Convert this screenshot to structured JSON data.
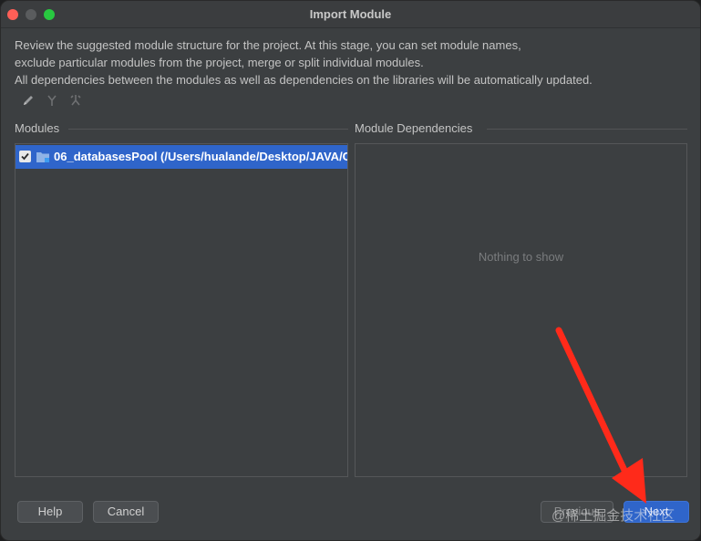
{
  "window": {
    "title": "Import Module"
  },
  "description": {
    "line1": "Review the suggested module structure for the project. At this stage, you can set module names,",
    "line2": "exclude particular modules from the project, merge or split individual modules.",
    "line3": "All dependencies between the modules as well as dependencies on the libraries will be automatically updated."
  },
  "toolbar": {
    "icons": [
      "pencil-icon",
      "merge-icon",
      "split-icon"
    ]
  },
  "modules": {
    "label": "Modules",
    "items": [
      {
        "checked": true,
        "text": "06_databasesPool (/Users/hualande/Desktop/JAVA/Co"
      }
    ]
  },
  "dependencies": {
    "label": "Module Dependencies",
    "empty_text": "Nothing to show"
  },
  "buttons": {
    "help": "Help",
    "cancel": "Cancel",
    "previous": "Previous",
    "next": "Next"
  },
  "watermark": "@稀土掘金技术社区",
  "colors": {
    "selection": "#2f65ca",
    "window_bg": "#3c3f41",
    "annotation_arrow": "#ff2a1a"
  }
}
